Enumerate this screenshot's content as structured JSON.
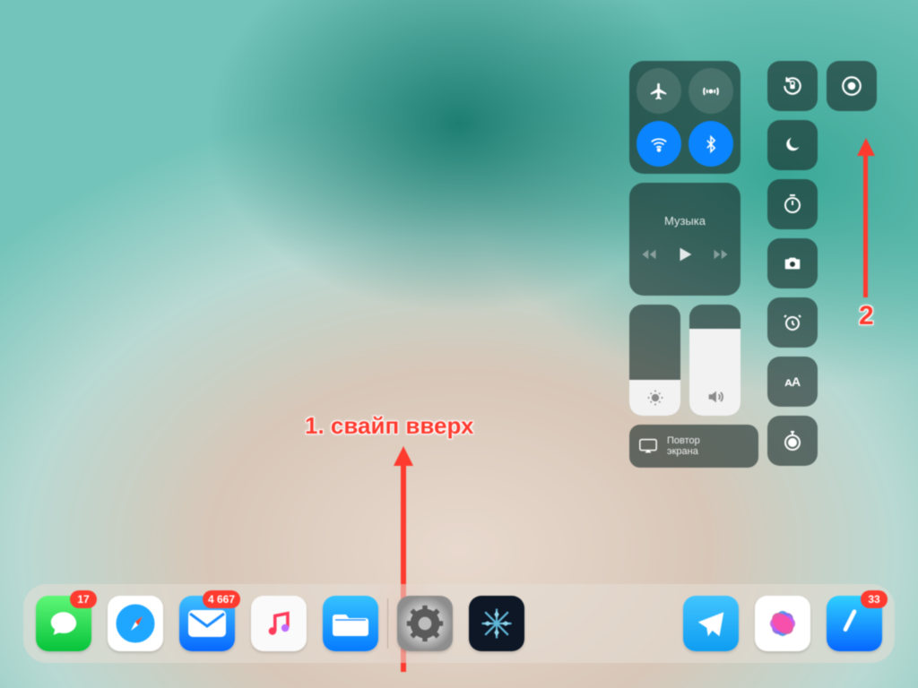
{
  "control_center": {
    "connectivity": {
      "airplane": {
        "on": false
      },
      "cellular": {
        "on": false
      },
      "wifi": {
        "on": true
      },
      "bluetooth": {
        "on": true
      }
    },
    "music": {
      "label": "Музыка"
    },
    "brightness": {
      "level_pct": 32
    },
    "volume": {
      "level_pct": 78
    },
    "mirror": {
      "label": "Повтор\nэкрана"
    }
  },
  "dock": {
    "messages_badge": "17",
    "mail_badge": "4 667",
    "appstore_badge": "33"
  },
  "annotations": {
    "step1": "1. свайп вверх",
    "step2": "2"
  }
}
